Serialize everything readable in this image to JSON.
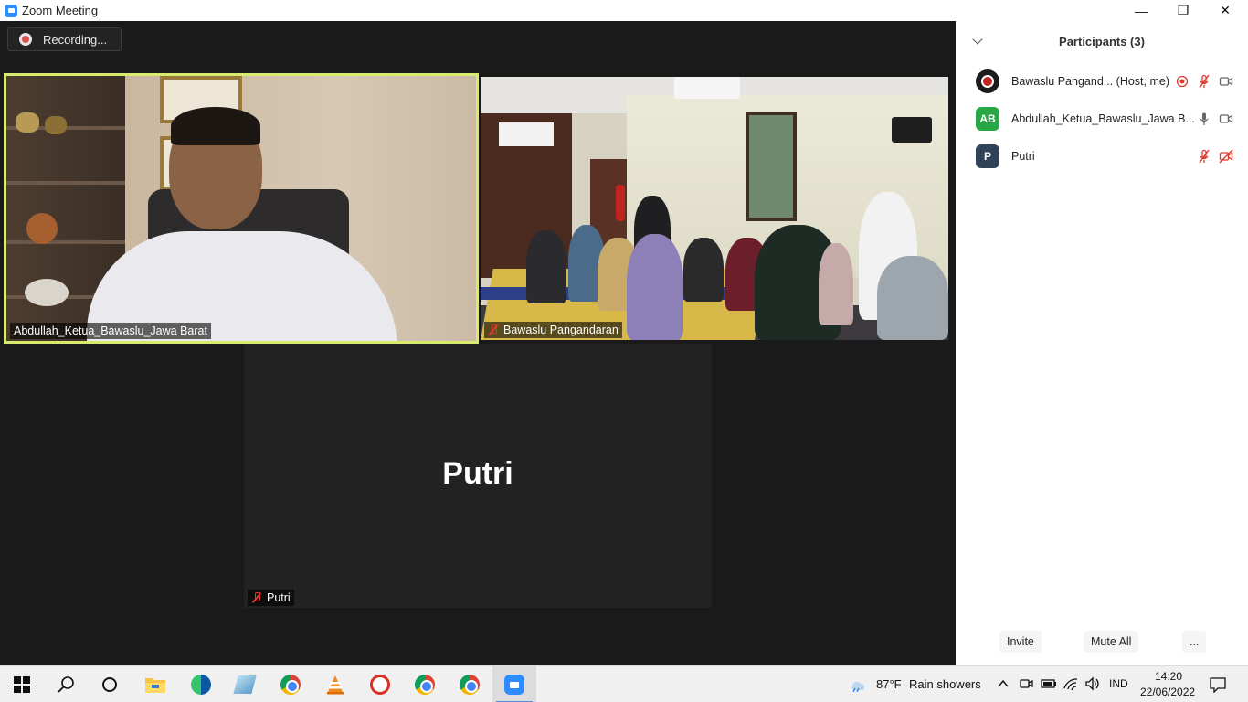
{
  "window": {
    "title": "Zoom Meeting",
    "minimize_glyph": "—",
    "restore_glyph": "❐",
    "close_glyph": "✕"
  },
  "recording": {
    "label": "Recording..."
  },
  "tiles": [
    {
      "label": "Abdullah_Ketua_Bawaslu_Jawa Barat",
      "active_speaker": true
    },
    {
      "label": "Bawaslu Pangandaran",
      "muted": true
    },
    {
      "label": "Putri",
      "muted": true,
      "display_name": "Putri"
    }
  ],
  "participants": {
    "title": "Participants (3)",
    "list": [
      {
        "name": "Bawaslu Pangand... (Host, me)",
        "avatar": "",
        "mic": "muted",
        "video": "on",
        "recording": true
      },
      {
        "name": "Abdullah_Ketua_Bawaslu_Jawa B...",
        "avatar": "AB",
        "avatar_color": "#27a745",
        "mic": "on",
        "video": "on"
      },
      {
        "name": "Putri",
        "avatar": "P",
        "avatar_color": "#2f4257",
        "mic": "muted",
        "video": "off"
      }
    ],
    "footer": {
      "invite": "Invite",
      "mute_all": "Mute All",
      "more": "..."
    }
  },
  "taskbar": {
    "weather": {
      "temp": "87°F",
      "desc": "Rain showers"
    },
    "language": "IND",
    "time": "14:20",
    "date": "22/06/2022"
  },
  "colors": {
    "active_speaker_border": "#d8eb6f",
    "muted_red": "#e0382f",
    "zoom_blue": "#2d8cff"
  }
}
